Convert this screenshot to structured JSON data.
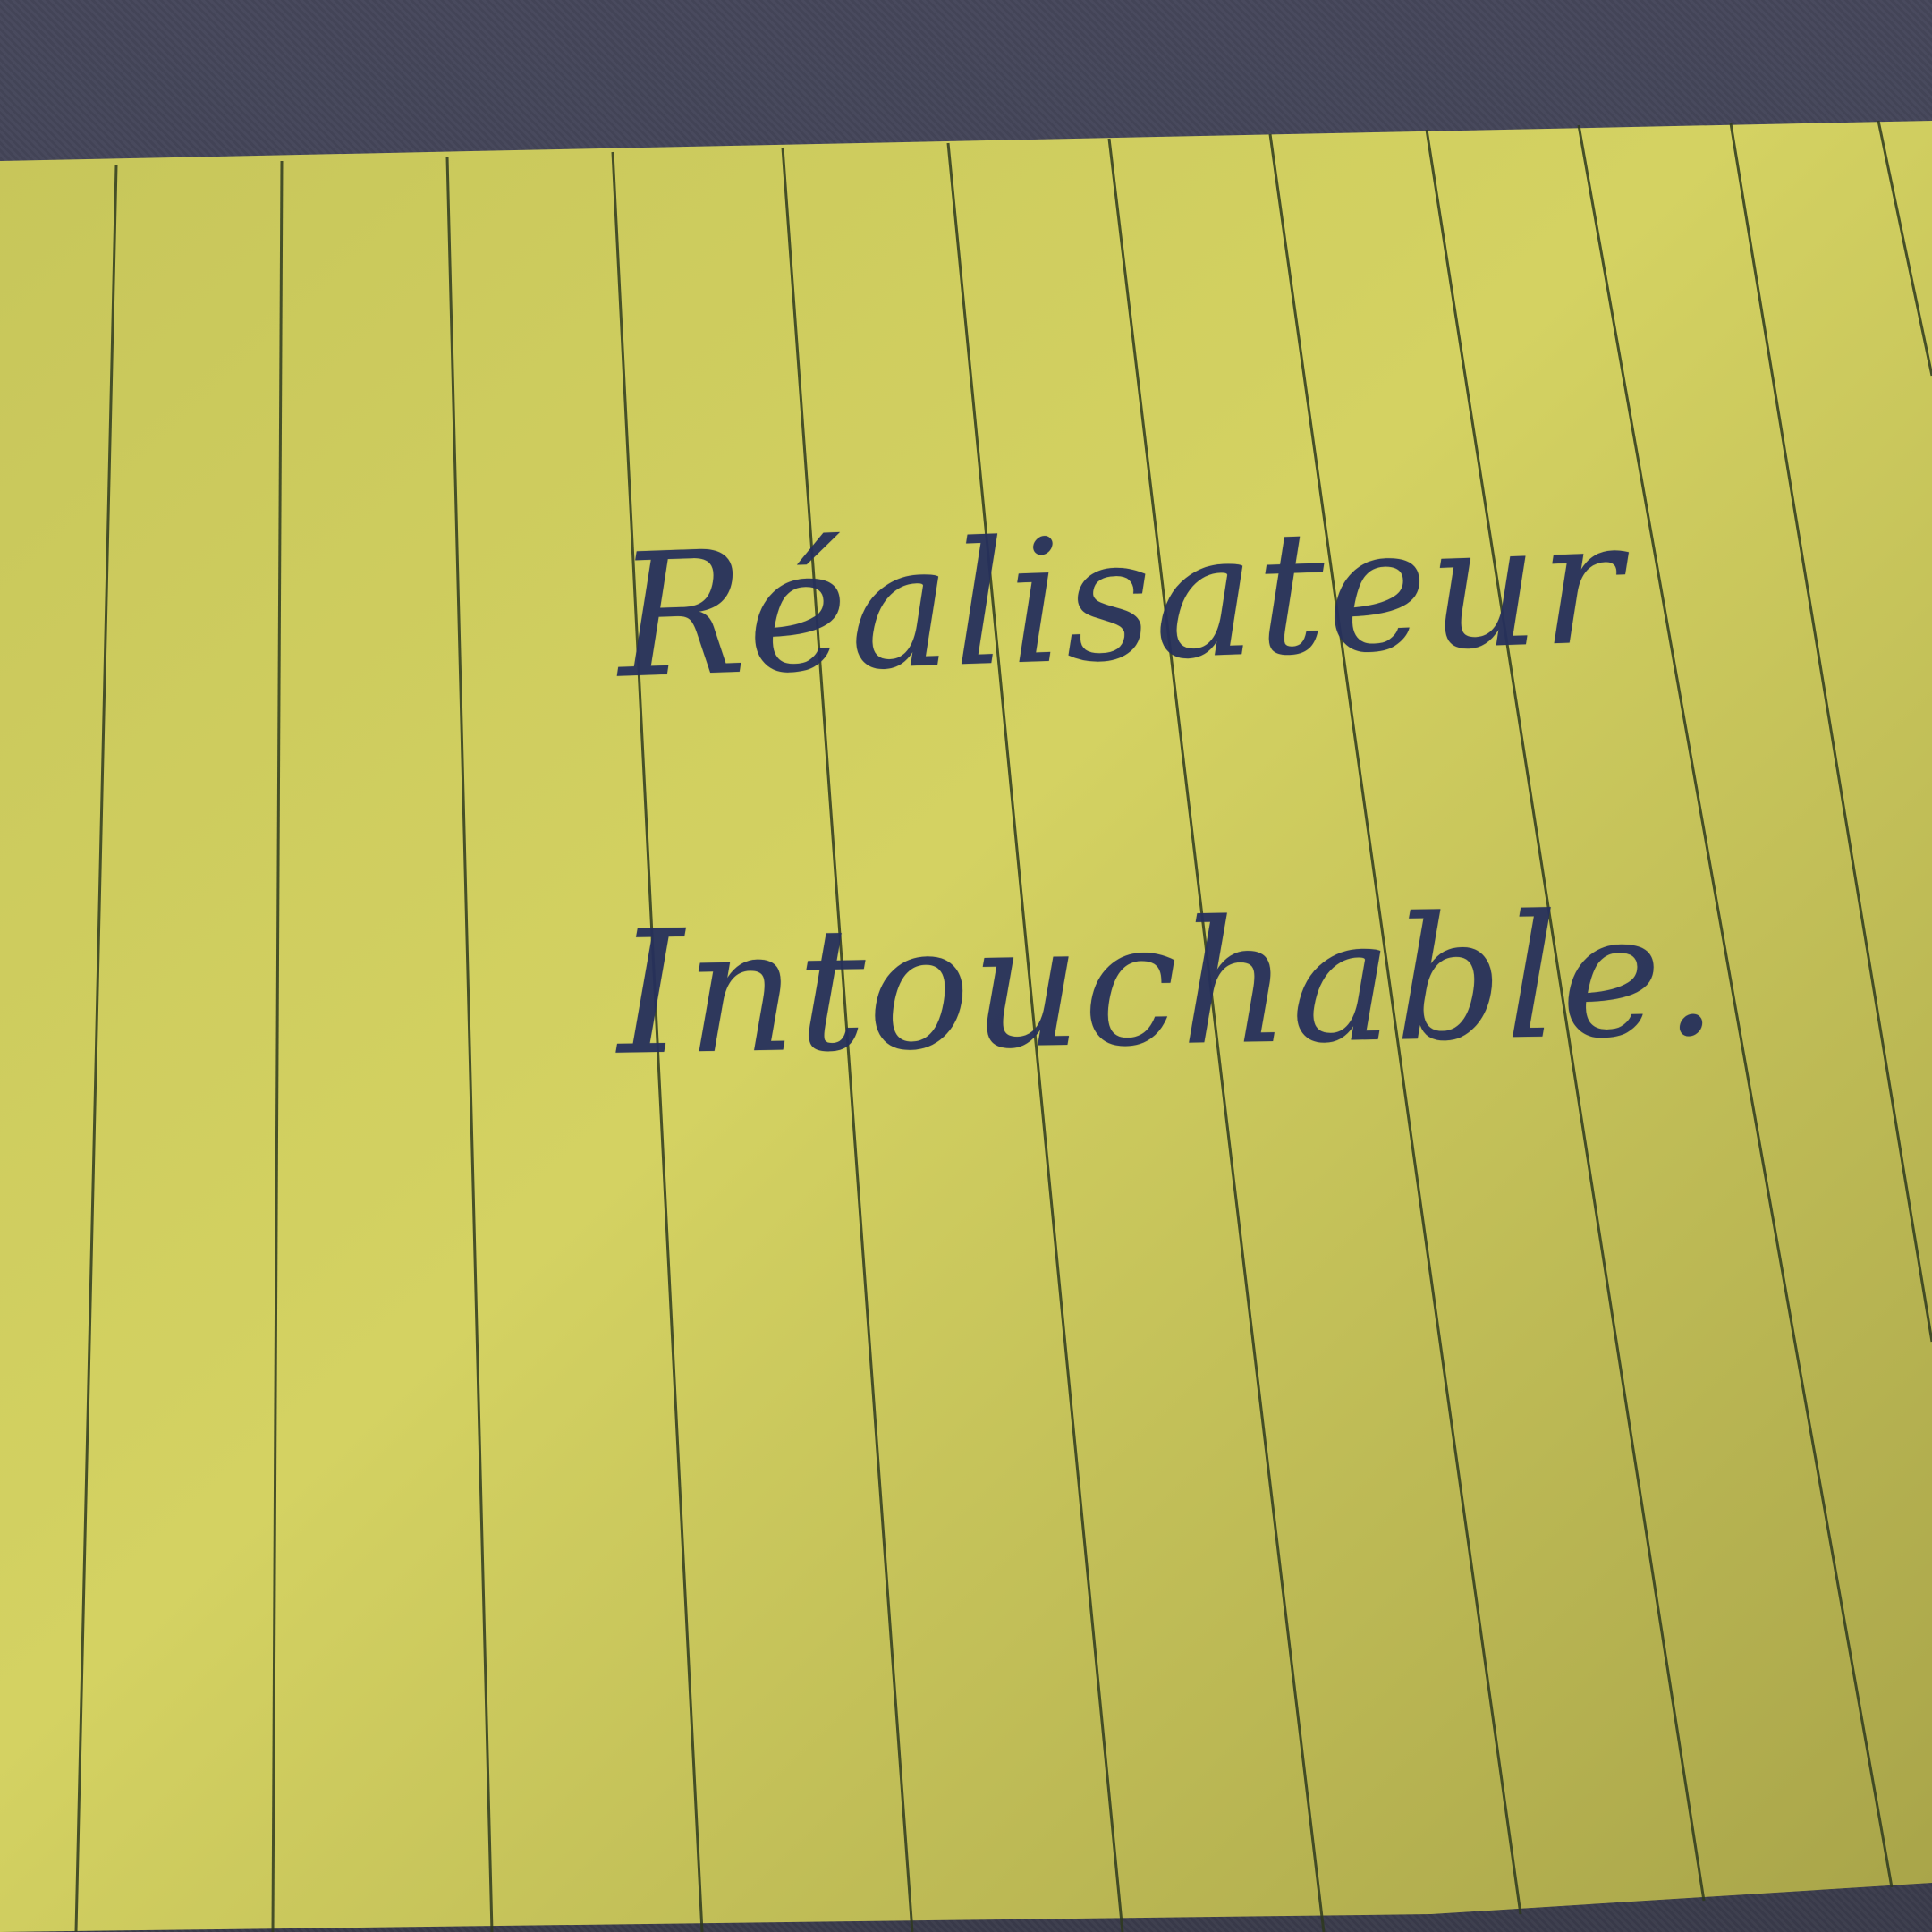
{
  "photo": {
    "subject": "index-card",
    "colors": {
      "background": "#3c3d4c",
      "card": "#cfcd5e",
      "card_shadow": "#a9a84a",
      "ruling": "#2e3a1e",
      "ink": "#26305c"
    }
  },
  "card": {
    "handwriting": {
      "line_1": "Réalisateur",
      "line_2": "Intouchable."
    }
  }
}
